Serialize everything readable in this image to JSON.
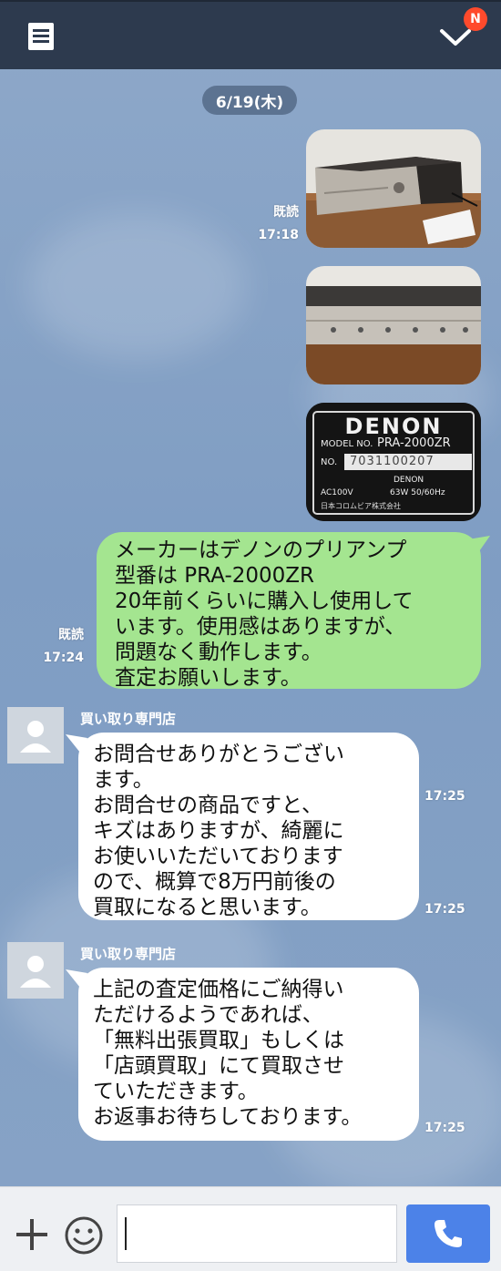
{
  "header": {
    "badge": "N"
  },
  "date_divider": "6/19(木)",
  "sent": [
    {
      "type": "photo",
      "read": "既読",
      "time": "17:18",
      "alt": "amplifier-front"
    },
    {
      "type": "photo",
      "alt": "amplifier-panel"
    },
    {
      "type": "photo",
      "alt": "model-plate",
      "plate": {
        "brand": "DENON",
        "model_label": "MODEL NO.",
        "model": "PRA-2000ZR",
        "serial_label": "NO.",
        "serial": "7031100207",
        "brand_small": "DENON",
        "power": "AC100V",
        "rating": "63W 50/60Hz",
        "maker": "日本コロムビア株式会社"
      }
    },
    {
      "type": "text",
      "read": "既読",
      "time": "17:24",
      "lines": [
        "メーカーはデノンのプリアンプ",
        "型番は PRA-2000ZR",
        "20年前くらいに購入し使用して",
        "います。使用感はありますが、",
        "問題なく動作します。",
        "査定お願いします。"
      ]
    }
  ],
  "received": [
    {
      "sender": "買い取り専門店",
      "time_top": "17:25",
      "time_bottom": "17:25",
      "lines": [
        "お問合せありがとうござい",
        "ます。",
        "お問合せの商品ですと、",
        "キズはありますが、綺麗に",
        "お使いいただいております",
        "ので、概算で8万円前後の",
        "買取になると思います。"
      ]
    },
    {
      "sender": "買い取り専門店",
      "time": "17:25",
      "lines": [
        "上記の査定価格にご納得い",
        "ただけるようであれば、",
        "「無料出張買取」もしくは",
        "「店頭買取」にて買取させ",
        "ていただきます。",
        "お返事お待ちしております。"
      ]
    }
  ],
  "composer": {
    "value": ""
  },
  "colors": {
    "header": "#2d3a4e",
    "sent_bubble": "#a4e590",
    "received_bubble": "#ffffff",
    "call": "#4c82e8",
    "badge": "#ff4a2c"
  }
}
